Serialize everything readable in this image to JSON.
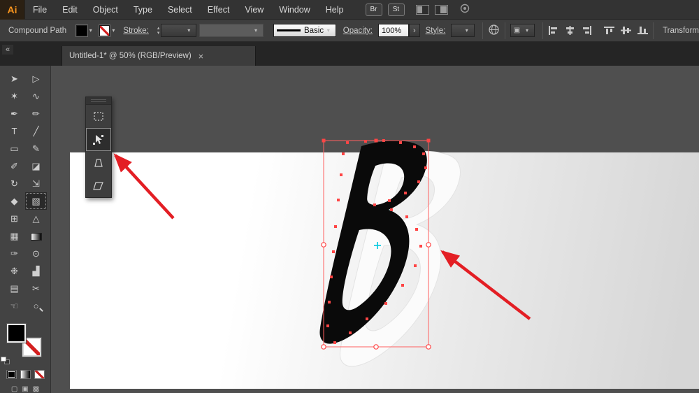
{
  "menubar": {
    "logo": "Ai",
    "items": [
      "File",
      "Edit",
      "Object",
      "Type",
      "Select",
      "Effect",
      "View",
      "Window",
      "Help"
    ],
    "badges": [
      "Br",
      "St"
    ]
  },
  "controlbar": {
    "context_label": "Compound Path",
    "stroke_label": "Stroke:",
    "stepper_up": "▴",
    "stepper_down": "▾",
    "dd_arrow": "▾",
    "brush_label": "Basic",
    "opacity_label": "Opacity:",
    "opacity_value": "100%",
    "expand_arrow": "›",
    "style_label": "Style:",
    "transform_label": "Transform"
  },
  "tabbar": {
    "collapse": "«",
    "title": "Untitled-1* @ 50% (RGB/Preview)",
    "close": "×"
  },
  "toolbar": {
    "tools": [
      {
        "name": "selection",
        "glyph": "➤"
      },
      {
        "name": "direct-selection",
        "glyph": "▷"
      },
      {
        "name": "magic-wand",
        "glyph": "✶"
      },
      {
        "name": "lasso",
        "glyph": "∿"
      },
      {
        "name": "pen",
        "glyph": "✒"
      },
      {
        "name": "curvature",
        "glyph": "✏"
      },
      {
        "name": "type",
        "glyph": "T"
      },
      {
        "name": "line-segment",
        "glyph": "╱"
      },
      {
        "name": "rectangle",
        "glyph": "▭"
      },
      {
        "name": "paintbrush",
        "glyph": "✎"
      },
      {
        "name": "shaper",
        "glyph": "✐"
      },
      {
        "name": "eraser",
        "glyph": "◪"
      },
      {
        "name": "rotate",
        "glyph": "↻"
      },
      {
        "name": "scale",
        "glyph": "⇲"
      },
      {
        "name": "width",
        "glyph": "◆"
      },
      {
        "name": "free-transform",
        "glyph": "▧"
      },
      {
        "name": "shape-builder",
        "glyph": "⊞"
      },
      {
        "name": "perspective-grid",
        "glyph": "△"
      },
      {
        "name": "mesh",
        "glyph": "▦"
      },
      {
        "name": "gradient",
        "glyph": ""
      },
      {
        "name": "eyedropper",
        "glyph": "✑"
      },
      {
        "name": "blend",
        "glyph": "⊙"
      },
      {
        "name": "symbol-sprayer",
        "glyph": "❉"
      },
      {
        "name": "graph",
        "glyph": "▟"
      },
      {
        "name": "artboard",
        "glyph": "▤"
      },
      {
        "name": "slice",
        "glyph": "✂"
      },
      {
        "name": "hand",
        "glyph": "☜"
      },
      {
        "name": "zoom",
        "glyph": "○"
      }
    ],
    "modes": [
      "▢",
      "▣",
      "▩"
    ]
  },
  "float_panel": {
    "tools": [
      "constrain",
      "free-transform",
      "perspective-distort",
      "free-distort"
    ],
    "selected": "free-transform"
  },
  "artwork": {
    "letter": "B"
  },
  "colors": {
    "selection": "#ff4545",
    "annotation_arrow": "#e31e24",
    "logo_accent": "#f7941e",
    "cyan_marker": "#00c8e0"
  }
}
